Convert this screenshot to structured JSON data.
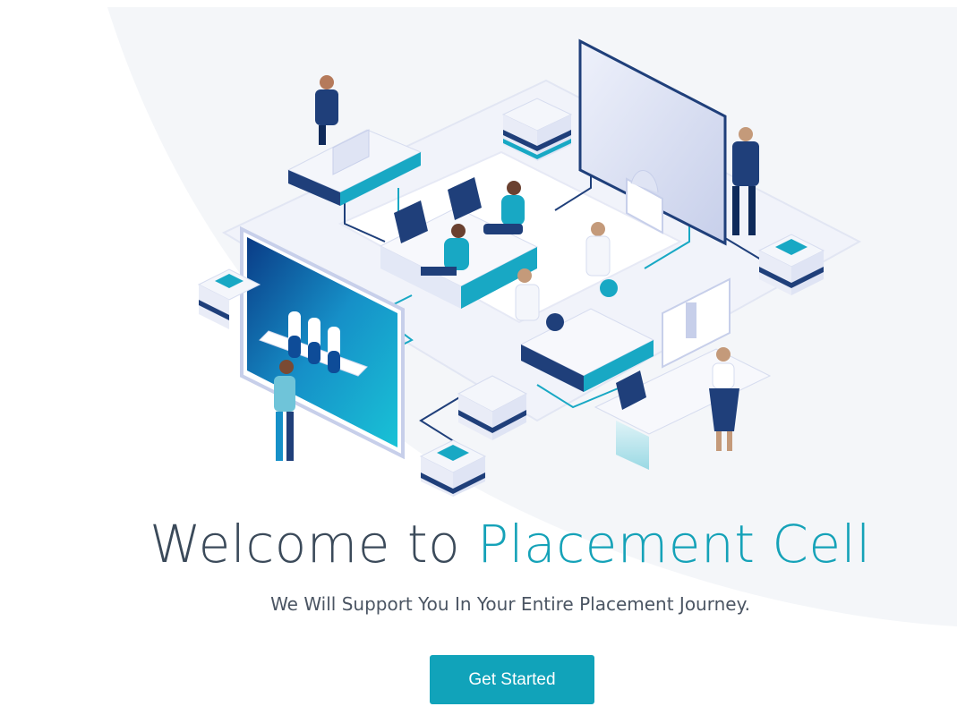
{
  "hero": {
    "title_part1": "Welcome to ",
    "title_part2": "Placement Cell",
    "subtitle": "We Will Support You In Your Entire Placement Journey.",
    "cta_label": "Get Started"
  },
  "colors": {
    "title_dark": "#3b4a5a",
    "accent": "#15a2b8",
    "button_bg": "#11a3ba",
    "illustration_navy": "#1f3f7a",
    "illustration_light": "#e3e8f6"
  },
  "illustration": {
    "icon": "isometric-office-illustration"
  }
}
